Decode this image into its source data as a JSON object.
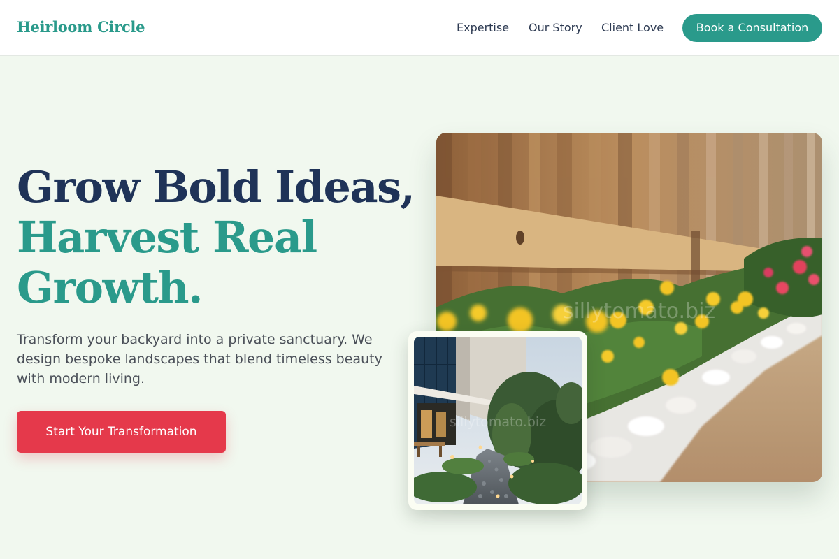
{
  "brand": {
    "name": "Heirloom Circle"
  },
  "nav": {
    "links": [
      "Expertise",
      "Our Story",
      "Client Love"
    ],
    "cta_label": "Book a Consultation"
  },
  "hero": {
    "headline_line1": "Grow Bold Ideas,",
    "headline_line2": "Harvest Real",
    "headline_line3": "Growth.",
    "description": "Transform your backyard into a private sanctuary. We design bespoke landscapes that blend timeless beauty with modern living.",
    "cta_label": "Start Your Transformation"
  },
  "images": {
    "main_watermark": "sillytomato.biz",
    "inset_watermark": "sillytomato.biz"
  },
  "colors": {
    "teal": "#2a9a8b",
    "navy": "#1f3358",
    "cta_red": "#e5394b",
    "background": "#f1f8ef"
  }
}
